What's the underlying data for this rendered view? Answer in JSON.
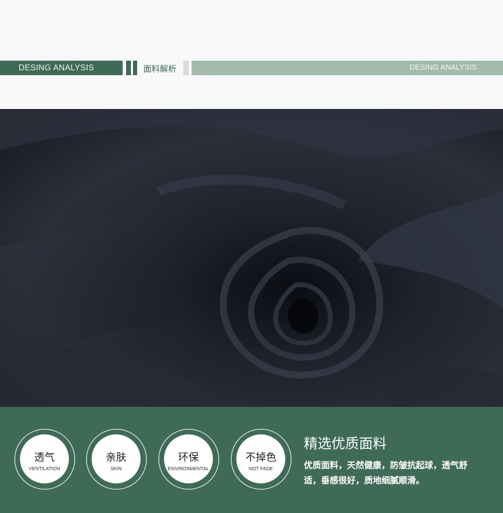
{
  "header": {
    "left_label": "DESING ANALYSIS",
    "center_label": "面料解析",
    "right_label": "DESING ANALYSIS"
  },
  "photo": {
    "subject": "fabric-swirl-image"
  },
  "features": [
    {
      "cn": "透气",
      "en": "VENTILATION"
    },
    {
      "cn": "亲肤",
      "en": "SKIN"
    },
    {
      "cn": "环保",
      "en": "ENVIRONMENTAL"
    },
    {
      "cn": "不掉色",
      "en": "NOT FADE"
    }
  ],
  "description": {
    "title": "精选优质面料",
    "body": "优质面料，天然健康，防皱抗起球，透气舒适，垂感很好，质地细腻顺滑。"
  },
  "colors": {
    "accent": "#3e6a57",
    "light_bar": "#a2b9ab",
    "fabric": "#1c1f28"
  }
}
